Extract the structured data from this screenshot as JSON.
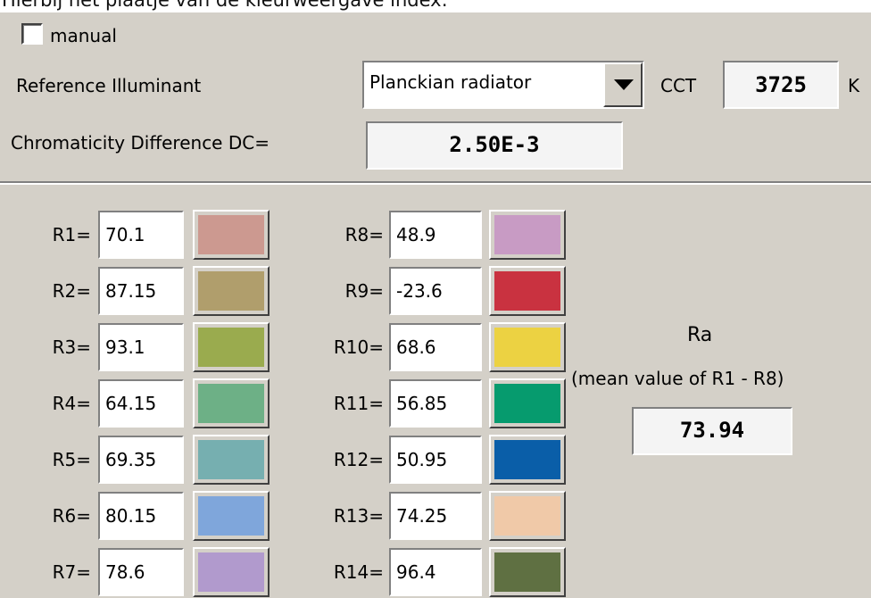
{
  "caption": "Hierbij het plaatje van de kleurweergave index:",
  "manual": {
    "label": "manual",
    "checked": false
  },
  "reference": {
    "label": "Reference Illuminant",
    "selected": "Planckian radiator",
    "cct_label": "CCT",
    "cct_value": "3725",
    "cct_unit": "K"
  },
  "dc": {
    "label": "Chromaticity Difference DC=",
    "value": "2.50E-3"
  },
  "ri_left": [
    {
      "label": "R1=",
      "value": "70.1",
      "color": "#cc9990"
    },
    {
      "label": "R2=",
      "value": "87.15",
      "color": "#b09e6c"
    },
    {
      "label": "R3=",
      "value": "93.1",
      "color": "#9aab4e"
    },
    {
      "label": "R4=",
      "value": "64.15",
      "color": "#6db086"
    },
    {
      "label": "R5=",
      "value": "69.35",
      "color": "#76afb0"
    },
    {
      "label": "R6=",
      "value": "80.15",
      "color": "#7fa6db"
    },
    {
      "label": "R7=",
      "value": "78.6",
      "color": "#b19acd"
    }
  ],
  "ri_right": [
    {
      "label": "R8=",
      "value": "48.9",
      "color": "#c89bc4"
    },
    {
      "label": "R9=",
      "value": "-23.6",
      "color": "#c93240"
    },
    {
      "label": "R10=",
      "value": "68.6",
      "color": "#ecd242"
    },
    {
      "label": "R11=",
      "value": "56.85",
      "color": "#069b6e"
    },
    {
      "label": "R12=",
      "value": "50.95",
      "color": "#0a5ea8"
    },
    {
      "label": "R13=",
      "value": "74.25",
      "color": "#f0c9a8"
    },
    {
      "label": "R14=",
      "value": "96.4",
      "color": "#5f7042"
    }
  ],
  "ra": {
    "title": "Ra",
    "subtitle": "(mean value of R1 - R8)",
    "value": "73.94"
  }
}
